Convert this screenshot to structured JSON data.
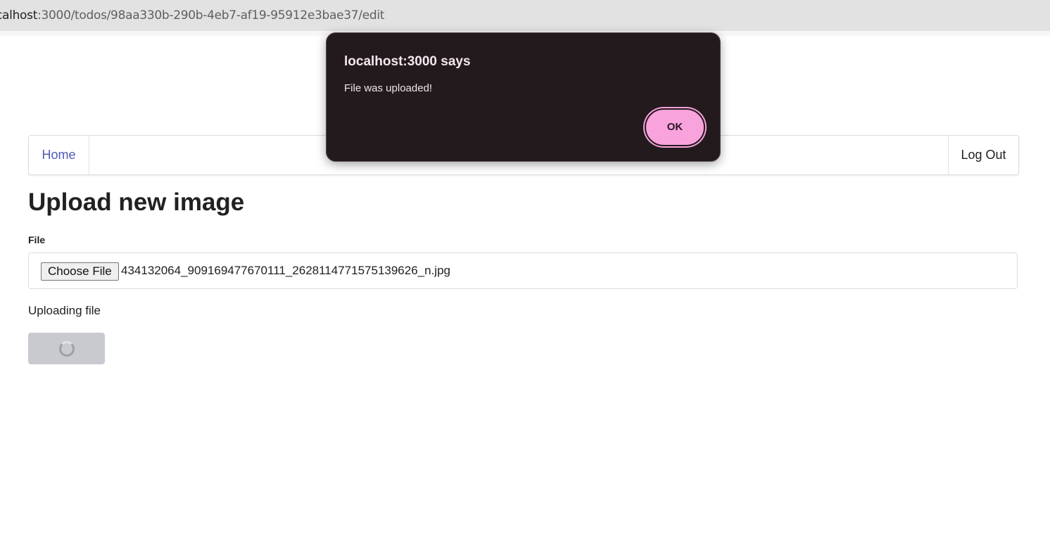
{
  "browser": {
    "url_host": "calhost",
    "url_path": ":3000/todos/98aa330b-290b-4eb7-af19-95912e3bae37/edit"
  },
  "nav": {
    "home_label": "Home",
    "logout_label": "Log Out"
  },
  "main": {
    "title": "Upload new image",
    "file_label": "File",
    "choose_file_label": "Choose File",
    "file_name": "434132064_909169477670111_2628114771575139626_n.jpg",
    "status_text": "Uploading file"
  },
  "dialog": {
    "title": "localhost:3000 says",
    "message": "File was uploaded!",
    "ok_label": "OK"
  },
  "colors": {
    "link": "#4f5ab5",
    "dialog_bg": "#231a1e",
    "dialog_ok": "#f9a3dc",
    "disabled_button": "#c9cacf"
  }
}
